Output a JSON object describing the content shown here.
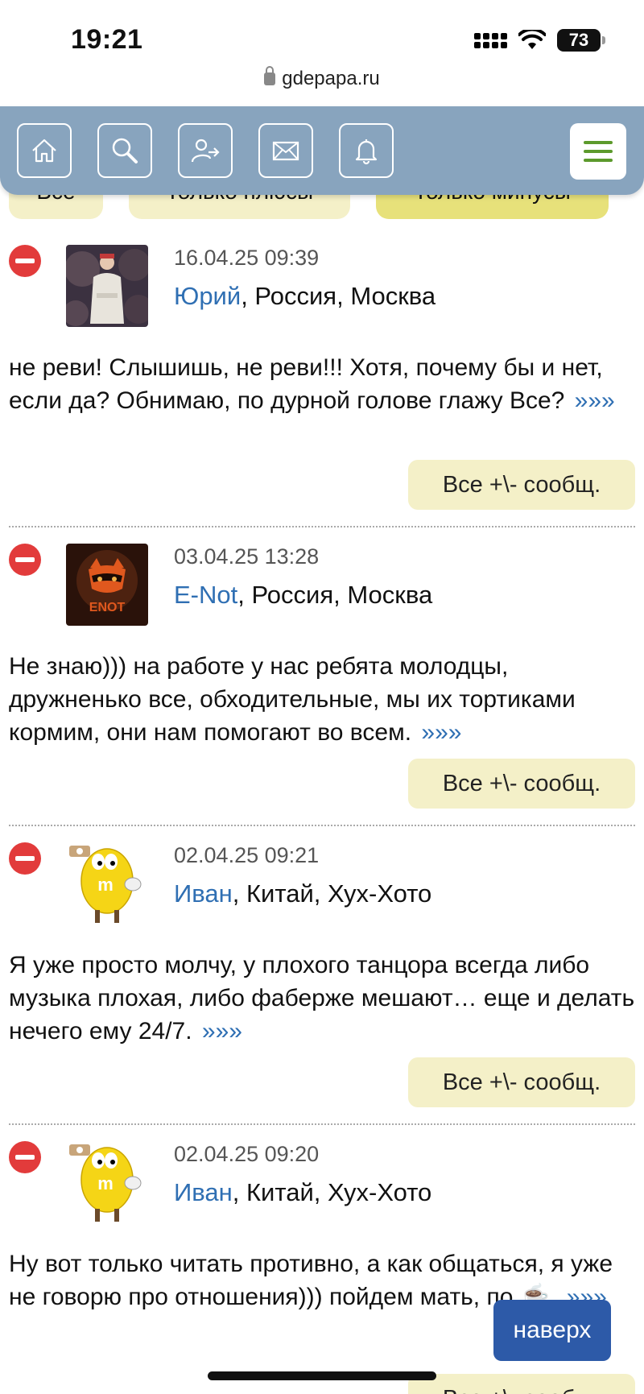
{
  "status": {
    "time": "19:21",
    "battery": "73"
  },
  "browser": {
    "url": "gdepapa.ru"
  },
  "filters": [
    {
      "label": "Все",
      "active": false
    },
    {
      "label": "Только плюсы",
      "active": false
    },
    {
      "label": "Только минусы",
      "active": true
    }
  ],
  "toolbar": {
    "icons": [
      "home-icon",
      "search-icon",
      "share-icon",
      "mail-icon",
      "bell-icon",
      "menu-icon"
    ]
  },
  "posts": [
    {
      "date": "16.04.25 09:39",
      "author": "Юрий",
      "location": ", Россия, Москва",
      "text": "не реви! Слышишь, не реви!!! Хотя, почему бы и нет, если да? Обнимаю, по дурной голове глажу Все?",
      "more": "»»»",
      "button": "Все +\\- сообщ."
    },
    {
      "date": "03.04.25 13:28",
      "author": "E-Not",
      "location": ", Россия, Москва",
      "text": "Не знаю))) на работе у нас ребята молодцы, дружненько все, обходительные, мы их тортиками кормим, они нам помогают во всем.",
      "more": "»»»",
      "button": "Все +\\- сообщ.",
      "avatar_text": "ENOT"
    },
    {
      "date": "02.04.25 09:21",
      "author": "Иван",
      "location": ", Китай, Хух-Хото",
      "text": "Я уже просто молчу, у плохого танцора всегда либо музыка плохая, либо фаберже мешают… еще и делать нечего ему 24/7.",
      "more": "»»»",
      "button": "Все +\\- сообщ."
    },
    {
      "date": "02.04.25 09:20",
      "author": "Иван",
      "location": ", Китай, Хух-Хото",
      "text": "Ну вот только читать противно, а как общаться, я уже не говорю про отношения))) пойдем мать, по ☕.",
      "more": "»»»",
      "button": "Все +\\- сообщ."
    }
  ],
  "to_top": "наверх",
  "colors": {
    "link": "#2f6fb3",
    "toolbar": "#88a4be",
    "pill": "#f4f0c8",
    "minus": "#e23b3b",
    "to_top": "#2d5aa8"
  }
}
